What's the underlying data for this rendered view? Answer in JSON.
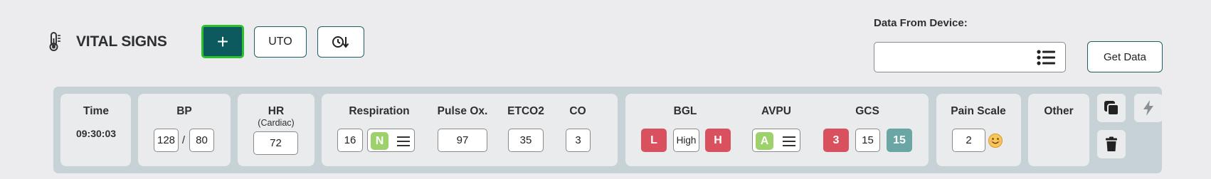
{
  "header": {
    "title": "VITAL SIGNS",
    "add_label": "+",
    "uto_label": "UTO",
    "thermometer_icon": "thermometer-icon",
    "clock_icon": "clock-sort-icon"
  },
  "device": {
    "label": "Data From Device:",
    "value": "",
    "list_icon": "list-icon",
    "get_data_label": "Get Data"
  },
  "vitals": {
    "time": {
      "label": "Time",
      "value": "09:30:03"
    },
    "bp": {
      "label": "BP",
      "systolic": "128",
      "separator": "/",
      "diastolic": "80"
    },
    "hr": {
      "label": "HR",
      "sublabel": "(Cardiac)",
      "value": "72"
    },
    "respiration": {
      "label": "Respiration",
      "value": "16",
      "status": "N"
    },
    "pulse_ox": {
      "label": "Pulse Ox.",
      "value": "97"
    },
    "etco2": {
      "label": "ETCO2",
      "value": "35"
    },
    "co": {
      "label": "CO",
      "value": "3"
    },
    "bgl": {
      "label": "BGL",
      "low": "L",
      "value": "High",
      "high": "H"
    },
    "avpu": {
      "label": "AVPU",
      "status": "A"
    },
    "gcs": {
      "label": "GCS",
      "score_a": "3",
      "score_b": "15",
      "total": "15"
    },
    "pain_scale": {
      "label": "Pain Scale",
      "value": "2",
      "icon": "smiley-face-icon"
    },
    "other": {
      "label": "Other"
    }
  },
  "actions": {
    "copy_icon": "copy-icon",
    "lightning_icon": "lightning-icon",
    "trash_icon": "trash-icon"
  },
  "colors": {
    "accent": "#0c5a5e",
    "focus_ring": "#2cc12c",
    "danger": "#d9515f",
    "normal": "#9dd16b",
    "total": "#6aa6a4",
    "bar_bg": "#c7d2d6"
  }
}
